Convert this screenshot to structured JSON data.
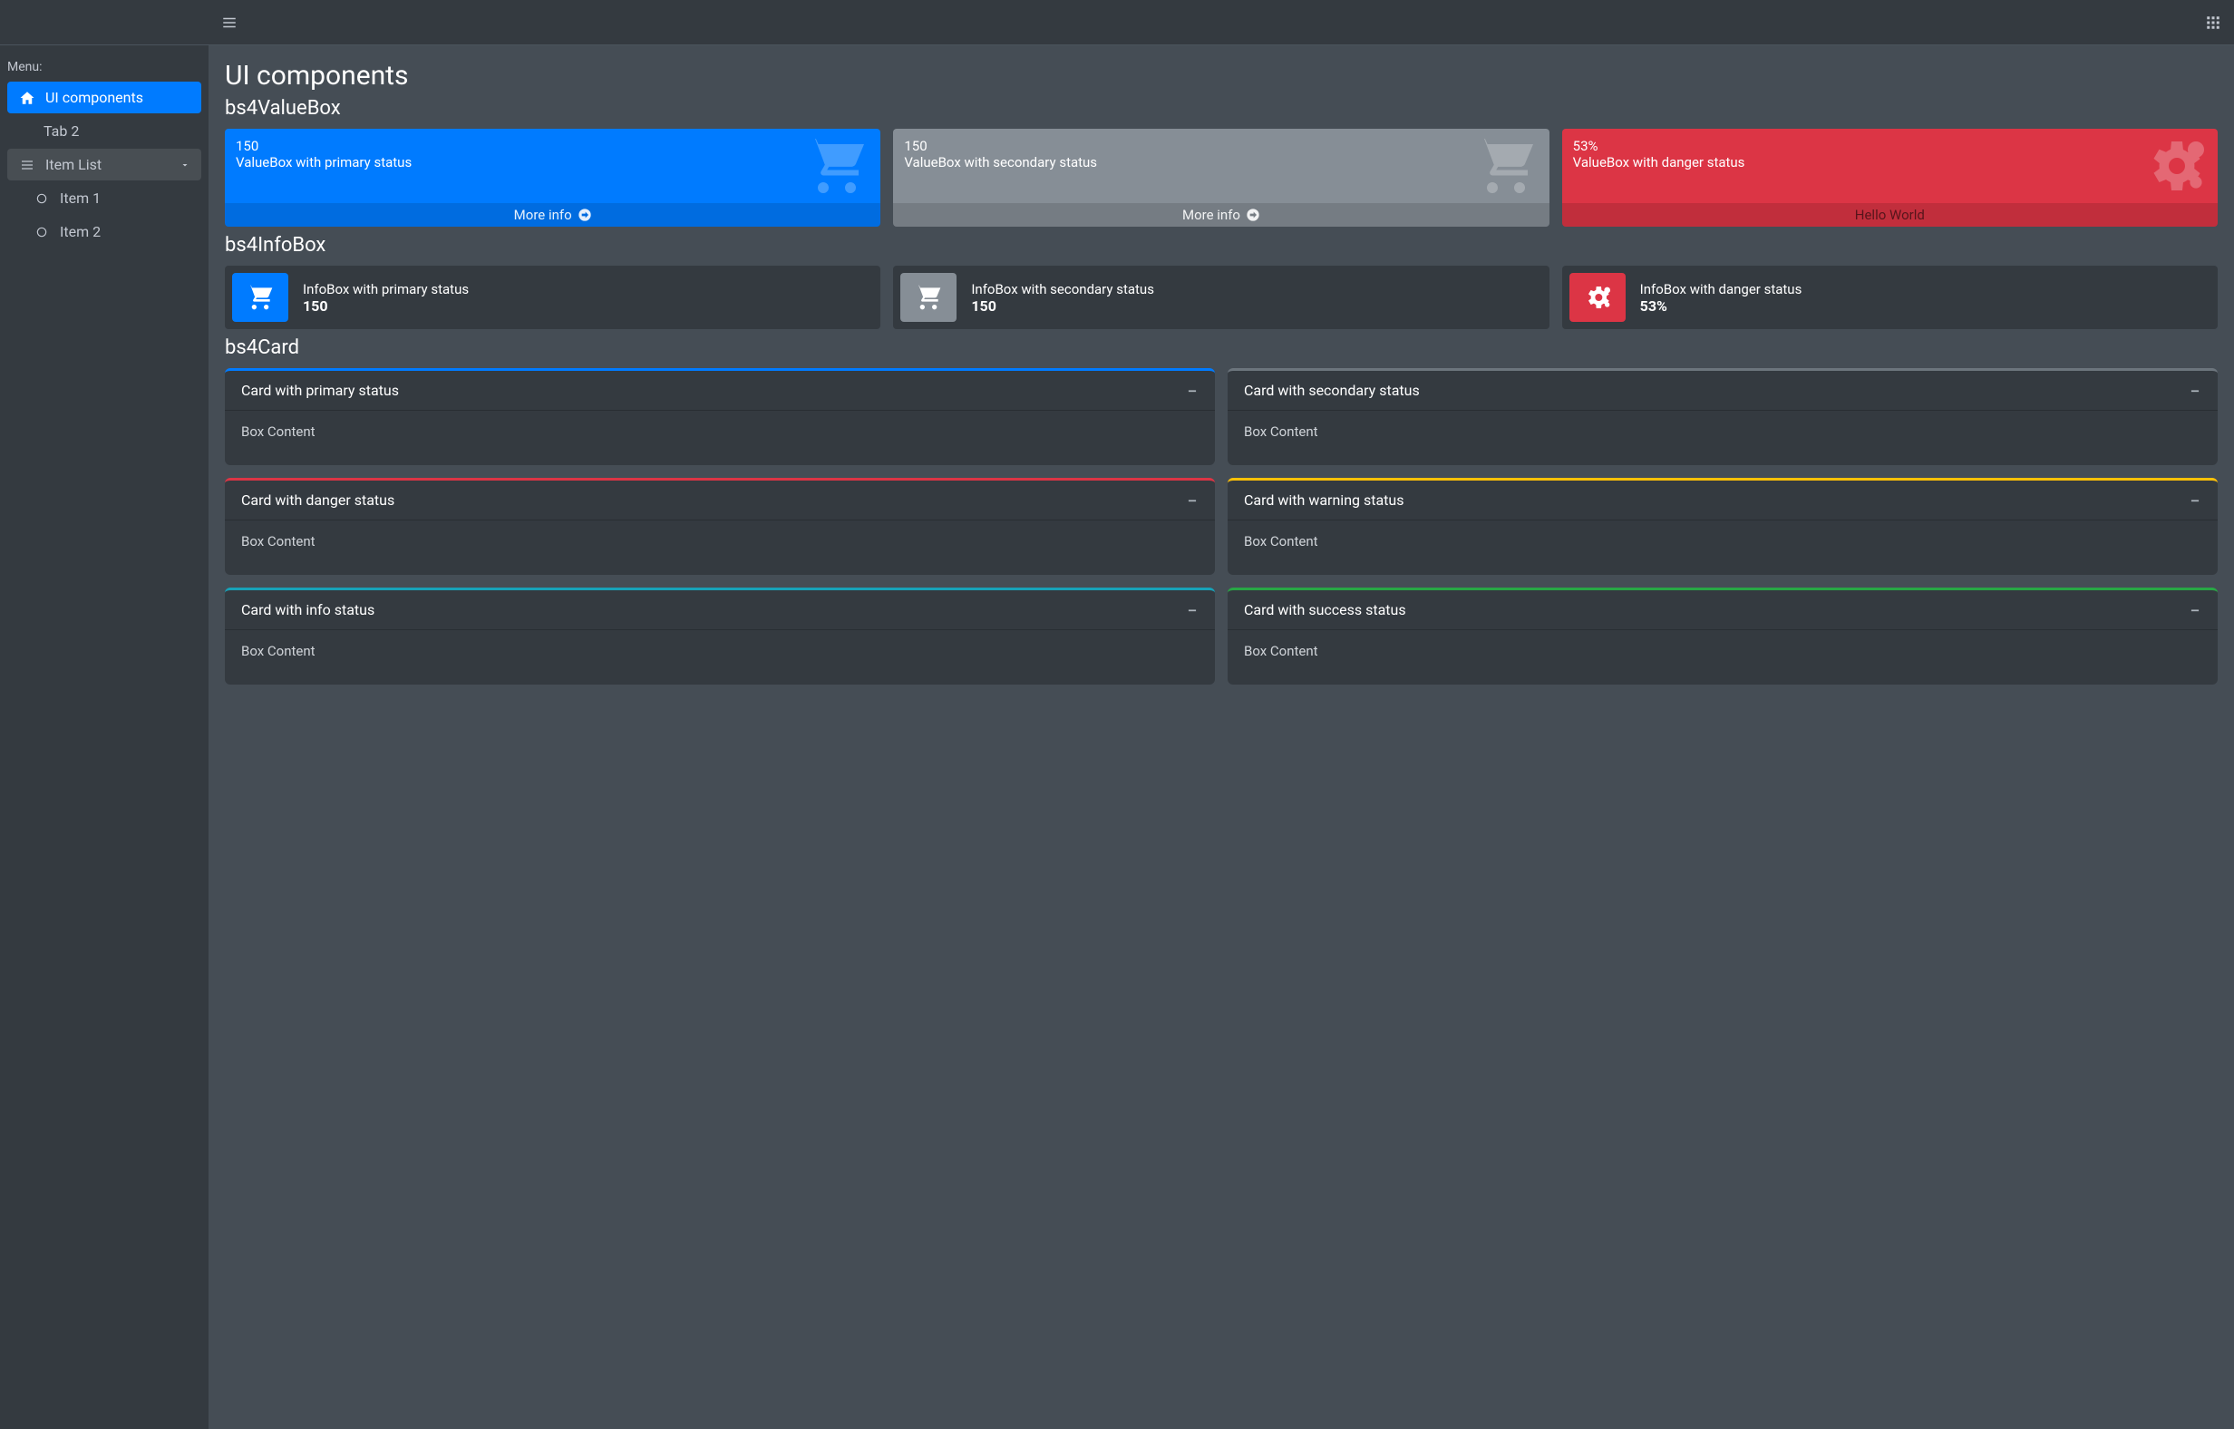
{
  "sidebar": {
    "label": "Menu:",
    "items": [
      {
        "label": "UI components"
      },
      {
        "label": "Tab 2"
      },
      {
        "label": "Item List"
      },
      {
        "label": "Item 1"
      },
      {
        "label": "Item 2"
      }
    ]
  },
  "page": {
    "title": "UI components",
    "sections": {
      "valuebox": "bs4ValueBox",
      "infobox": "bs4InfoBox",
      "card": "bs4Card"
    }
  },
  "valueboxes": [
    {
      "value": "150",
      "subtitle": "ValueBox with primary status",
      "footer": "More info"
    },
    {
      "value": "150",
      "subtitle": "ValueBox with secondary status",
      "footer": "More info"
    },
    {
      "value": "53%",
      "subtitle": "ValueBox with danger status",
      "footer": "Hello World"
    }
  ],
  "infoboxes": [
    {
      "title": "InfoBox with primary status",
      "value": "150"
    },
    {
      "title": "InfoBox with secondary status",
      "value": "150"
    },
    {
      "title": "InfoBox with danger status",
      "value": "53%"
    }
  ],
  "cards": [
    {
      "title": "Card with primary status",
      "body": "Box Content"
    },
    {
      "title": "Card with secondary status",
      "body": "Box Content"
    },
    {
      "title": "Card with danger status",
      "body": "Box Content"
    },
    {
      "title": "Card with warning status",
      "body": "Box Content"
    },
    {
      "title": "Card with info status",
      "body": "Box Content"
    },
    {
      "title": "Card with success status",
      "body": "Box Content"
    }
  ],
  "colors": {
    "primary": "#007bff",
    "secondary": "#868e96",
    "danger": "#dc3545",
    "warning": "#ffc107",
    "info": "#17a2b8",
    "success": "#28a745"
  }
}
